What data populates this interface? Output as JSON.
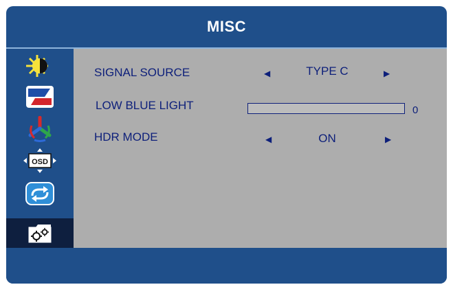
{
  "header": {
    "title": "MISC"
  },
  "sidebar": {
    "items": [
      {
        "icon": "brightness-contrast-icon",
        "active": false
      },
      {
        "icon": "image-icon",
        "active": false
      },
      {
        "icon": "color-icon",
        "active": false
      },
      {
        "icon": "osd-settings-icon",
        "active": false
      },
      {
        "icon": "reset-icon",
        "active": false
      },
      {
        "icon": "misc-settings-icon",
        "active": true
      }
    ],
    "osd_icon_text": "OSD"
  },
  "rows": {
    "signal_source": {
      "label": "SIGNAL SOURCE",
      "value": "TYPE C"
    },
    "low_blue_light": {
      "label": "LOW BLUE LIGHT",
      "value": "0",
      "level_percent": 0
    },
    "hdr_mode": {
      "label": "HDR MODE",
      "value": "ON"
    }
  },
  "colors": {
    "frame": "#1f4f8a",
    "panel": "#adadad",
    "text": "#0d1f7a",
    "active": "#0e1f3f"
  }
}
